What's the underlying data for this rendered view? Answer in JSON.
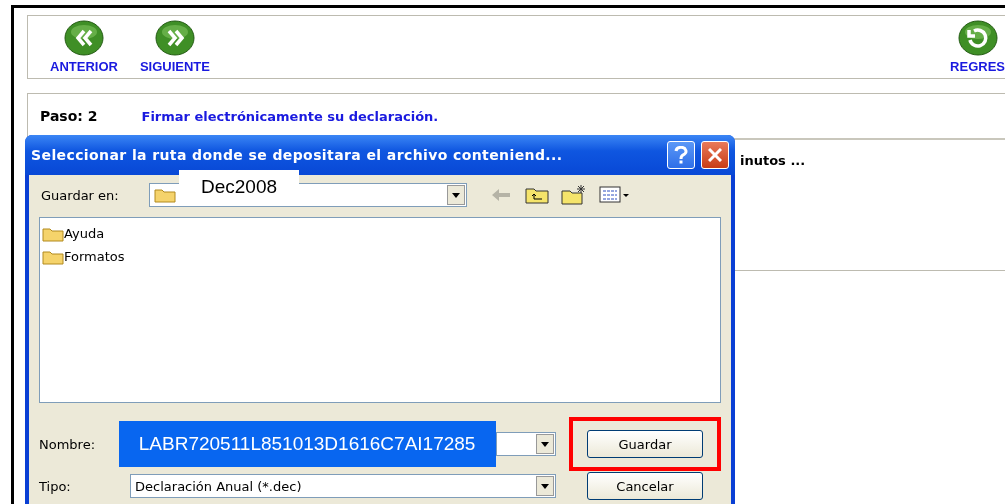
{
  "toolbar": {
    "buttons": [
      {
        "kind": "back",
        "label": "ANTERIOR"
      },
      {
        "kind": "forward",
        "label": "SIGUIENTE"
      },
      {
        "kind": "return",
        "label": "REGRES"
      }
    ]
  },
  "step": {
    "label": "Paso: 2",
    "title": "Firmar electrónicamente su declaración.",
    "message": "inutos ..."
  },
  "dialog": {
    "title": "Seleccionar la ruta donde se depositara el archivo conteniend...",
    "save_in_label": "Guardar en:",
    "save_in_value": "Dec2008",
    "files": [
      {
        "name": "Ayuda"
      },
      {
        "name": "Formatos"
      }
    ],
    "name_label": "Nombre:",
    "name_value": "LABR720511L851013D1616C7AI17285",
    "type_label": "Tipo:",
    "type_value": "Declaración Anual (*.dec)",
    "buttons": [
      {
        "label": "Guardar",
        "highlighted": true
      },
      {
        "label": "Cancelar",
        "highlighted": false
      }
    ]
  }
}
